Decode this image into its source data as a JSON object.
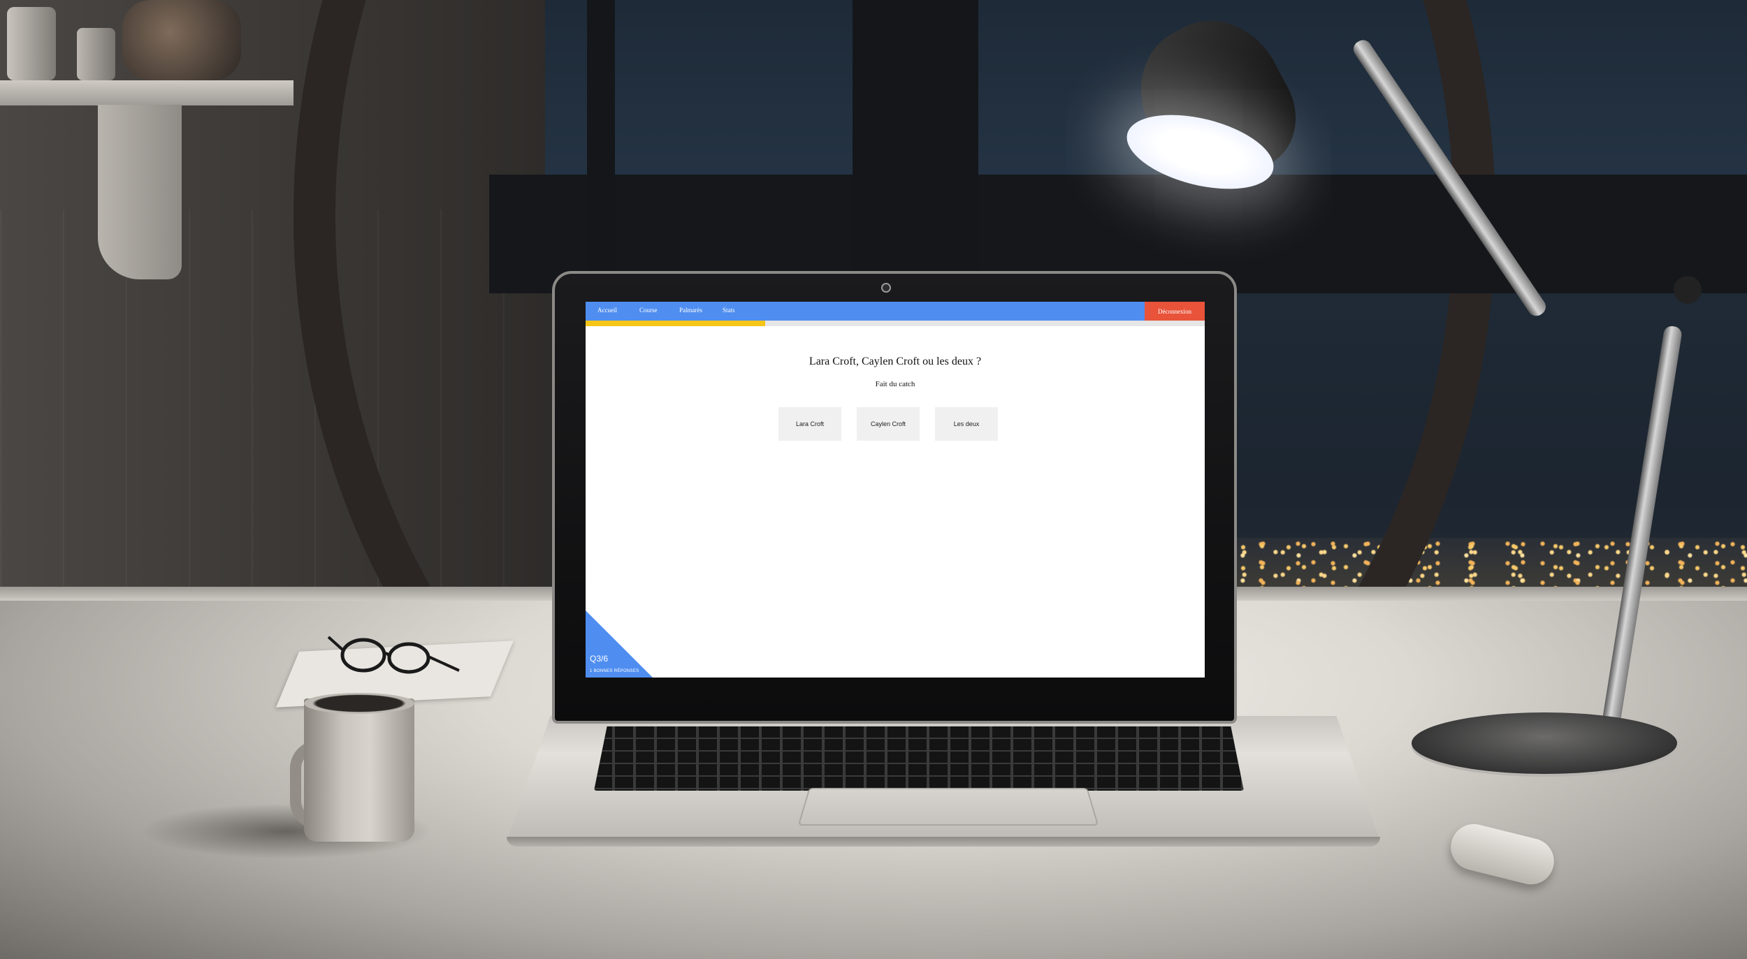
{
  "nav": {
    "links": [
      "Accueil",
      "Course",
      "Palmarès",
      "Stats"
    ],
    "logout_label": "Déconnexion",
    "color": "#4f8ef0",
    "logout_color": "#e8533a"
  },
  "progress": {
    "fraction": 0.29,
    "color": "#f5c518"
  },
  "quiz": {
    "question": "Lara Croft, Caylen Croft ou les deux ?",
    "hint": "Fait du catch",
    "answers": [
      "Lara Croft",
      "Caylen Croft",
      "Les deux"
    ]
  },
  "status": {
    "counter": "Q3/6",
    "caption": "1 BONNES RÉPONSES"
  },
  "icons": {
    "camera": "webcam-icon"
  }
}
